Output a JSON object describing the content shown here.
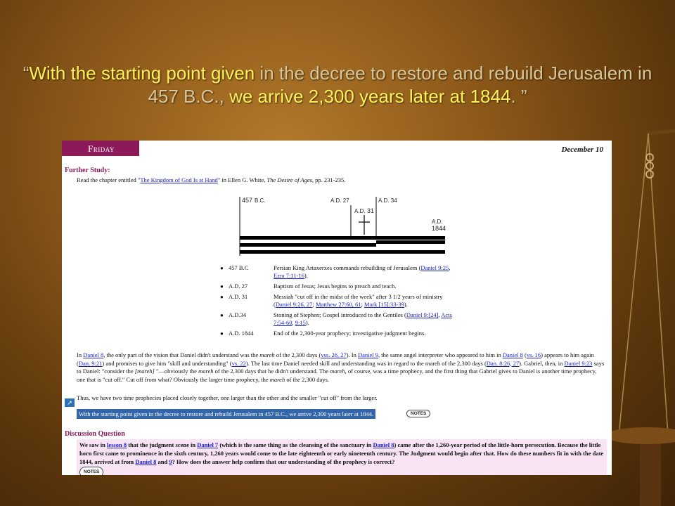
{
  "headline": {
    "open_quote": "“",
    "part1": "With the starting point given",
    "part2": " in the decree to restore and rebuild Jerusalem in 457 B.C., ",
    "part3": "we arrive 2,300 years later at 1844",
    "part4": ". ”"
  },
  "page": {
    "day": "Friday",
    "date": "December 10",
    "further_title": "Further Study:",
    "read_pre": "Read the chapter entitled \"",
    "read_link": "The Kingdom of God Is at Hand",
    "read_mid": "\" in Ellen G. White, ",
    "read_book": "The Desire of Ages",
    "read_post": ", pp. 231-235.",
    "timeline": {
      "labels": [
        "457",
        "B.C.",
        "A.D. 27",
        "A.D. 34",
        "A.D.",
        "31",
        "A.D.",
        "1844"
      ]
    },
    "events": [
      {
        "year": "457 B.C",
        "desc_pre": "Persian King Artaxerxes commands rebuilding of Jerusalem (",
        "l1": "Daniel 9:25",
        "mid": ", ",
        "l2": "Ezra 7:11-16",
        "desc_post": ")."
      },
      {
        "year": "A.D. 27",
        "desc_pre": "Baptism of Jesus; Jesus begins to preach and teach.",
        "l1": "",
        "mid": "",
        "l2": "",
        "desc_post": ""
      },
      {
        "year": "A.D. 31",
        "desc_pre": "Messiah \"cut off in the midst of the week\" after 3 1/2 years of ministry (",
        "l1": "Daniel 9:26, 27",
        "mid": "; ",
        "l2": "Matthew 27:60, 61",
        "mid2": "; ",
        "l3": "Mark [15]:33-39",
        "desc_post": ")."
      },
      {
        "year": "A.D.34",
        "desc_pre": "Stoning of Stephen; Gospel introduced to the Gentiles (",
        "l1": "Daniel 9:[24]",
        "mid": ", ",
        "l2": "Acts 7:54-60",
        "mid2": ", ",
        "l3": "9:15",
        "desc_post": ")."
      },
      {
        "year": "A.D. 1844",
        "desc_pre": "End of the 2,300-year prophecy; investigative judgment begins.",
        "l1": "",
        "mid": "",
        "l2": "",
        "desc_post": ""
      }
    ],
    "paragraph": {
      "t1": "In ",
      "l1": "Daniel 8",
      "t2": ", the only part of the vision that Daniel didn't understand was the ",
      "i1": "mareh",
      "t3": " of the 2,300 days (",
      "l2": "vss. 26, 27",
      "t4": "). In ",
      "l3": "Daniel 9",
      "t5": ", the same angel interpreter who appeared to him in ",
      "l4": "Daniel 8",
      "t6": " (",
      "l5": "vs. 16",
      "t7": ") appears to him again (",
      "l6": "Dan. 9:21",
      "t8": ") and promises to give him \"skill and understanding\" (",
      "l7": "vs. 22",
      "t9": "). The last time Daniel needed skill and understanding was in regard to the mareh of the 2,300 days (",
      "l8": "Dan. 8:26, 27",
      "t10": "). Gabriel, then, in ",
      "l9": "Daniel 9:23",
      "t11": " says to Daniel: \"consider the ",
      "i2": "[mareh]",
      "t12": " \"—obviously the ",
      "i3": "mareh",
      "t13": " of the 2,300 days that he didn't understand. The ",
      "i4": "mareh",
      "t14": ", of course, was a time prophecy, and the first thing that Gabriel gives to Daniel is another time prophecy, one that is \"cut off.\" Cut off from what? Obviously the larger time prophecy, the ",
      "i5": "mareh",
      "t15": " of the 2,300 days."
    },
    "thus": "Thus, we have two time prophecies placed closely together, one larger than the other and the smaller \"cut off\" from the larger.",
    "selected": "With the starting point given in the decree to restore and rebuild Jerusalem in 457 B.C., we arrive 2,300 years later at 1844.",
    "notes": "NOTES",
    "discussion_title": "Discussion Question",
    "discussion": {
      "t1": "We saw in ",
      "l1": "lesson 8",
      "t2": " that the judgment scene in ",
      "l2": "Daniel 7",
      "t3": " (which is the same thing as the cleansing of the sanctuary in ",
      "l3": "Daniel 8",
      "t4": ") came after the 1,260-year period of the little-horn persecution. Because the little horn first came to prominence in the sixth century, 1,260 years would come to the late eighteenth or early nineteenth century. The Judgment would begin after that. How do these numbers fit in with the date 1844, arrived at from ",
      "l4": "Daniel 8",
      "t5": " and ",
      "l5": "9",
      "t6": "? How does the answer help confirm that our understanding of the prophecy is correct?"
    }
  }
}
